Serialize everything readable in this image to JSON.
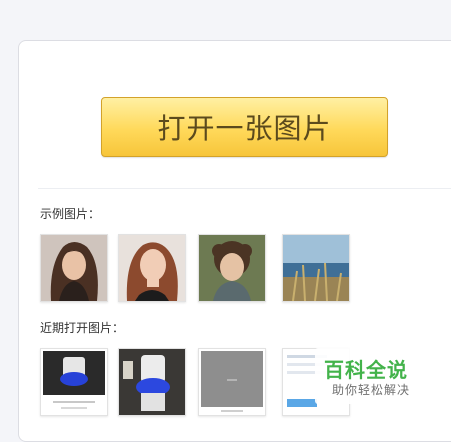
{
  "open_button_label": "打开一张图片",
  "sample_section": {
    "label": "示例图片：",
    "images": [
      {
        "icon": "portrait-woman-dark-hair"
      },
      {
        "icon": "portrait-woman-red-hair"
      },
      {
        "icon": "portrait-child-curly-hair"
      },
      {
        "icon": "landscape-sea-grass"
      }
    ]
  },
  "recent_section": {
    "label": "近期打开图片：",
    "images": [
      {
        "icon": "screenshot-blue-lamp"
      },
      {
        "icon": "photo-blue-lamp"
      },
      {
        "icon": "gray-screenshot"
      },
      {
        "icon": "webpage-screenshot"
      }
    ]
  },
  "watermark": {
    "title": "百科全说",
    "subtitle": "助你轻松解决"
  },
  "colors": {
    "button_top": "#fff0a3",
    "button_bottom": "#f7c53a",
    "button_text": "#5b4a1d",
    "watermark_green": "#43b34b"
  }
}
